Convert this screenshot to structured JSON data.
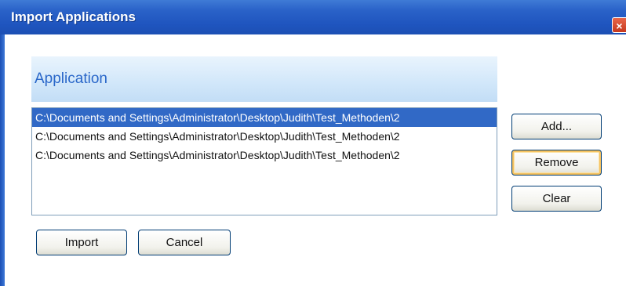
{
  "window": {
    "title": "Import Applications",
    "close_glyph": "×"
  },
  "header": {
    "label": "Application"
  },
  "list": {
    "items": [
      {
        "path": "C:\\Documents and Settings\\Administrator\\Desktop\\Judith\\Test_Methoden\\2",
        "selected": true
      },
      {
        "path": "C:\\Documents and Settings\\Administrator\\Desktop\\Judith\\Test_Methoden\\2",
        "selected": false
      },
      {
        "path": "C:\\Documents and Settings\\Administrator\\Desktop\\Judith\\Test_Methoden\\2",
        "selected": false
      }
    ]
  },
  "buttons": {
    "add": "Add...",
    "remove": "Remove",
    "clear": "Clear",
    "import": "Import",
    "cancel": "Cancel"
  },
  "colors": {
    "titlebar": "#2a62c8",
    "selection": "#3169c6",
    "header_text": "#2a67c9",
    "close_button": "#c6381e"
  },
  "icons": {
    "close": "close-icon"
  }
}
